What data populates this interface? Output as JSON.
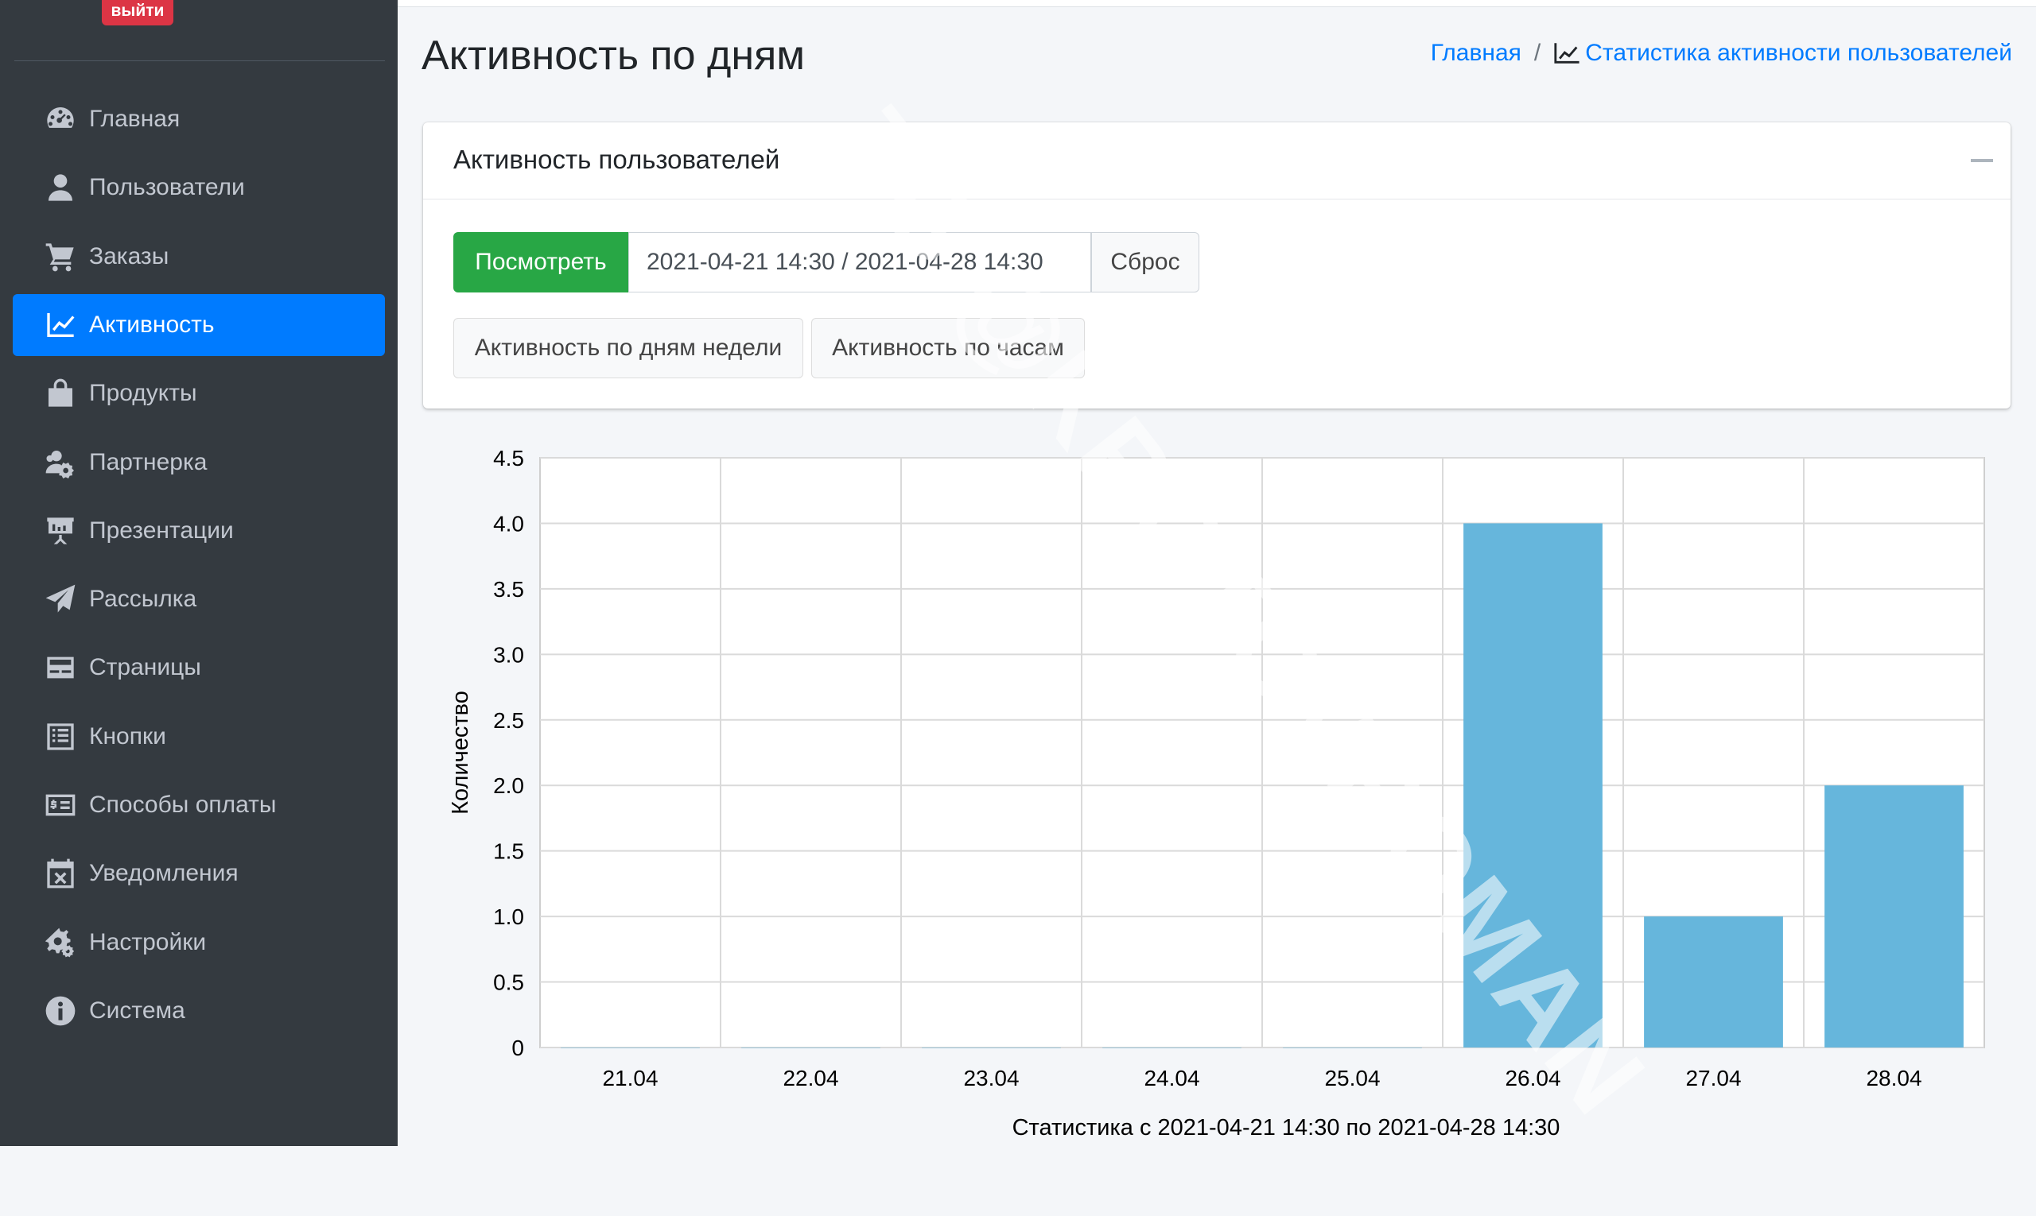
{
  "sidebar": {
    "logout_label": "выйти",
    "items": [
      {
        "label": "Главная",
        "icon": "dashboard-icon"
      },
      {
        "label": "Пользователи",
        "icon": "user-icon"
      },
      {
        "label": "Заказы",
        "icon": "cart-icon"
      },
      {
        "label": "Активность",
        "icon": "chart-line-icon",
        "active": true
      },
      {
        "label": "Продукты",
        "icon": "bag-icon"
      },
      {
        "label": "Партнерка",
        "icon": "users-cog-icon"
      },
      {
        "label": "Презентации",
        "icon": "presentation-icon"
      },
      {
        "label": "Рассылка",
        "icon": "paper-plane-icon"
      },
      {
        "label": "Страницы",
        "icon": "page-icon"
      },
      {
        "label": "Кнопки",
        "icon": "list-icon"
      },
      {
        "label": "Способы оплаты",
        "icon": "payment-card-icon"
      },
      {
        "label": "Уведомления",
        "icon": "calendar-x-icon"
      },
      {
        "label": "Настройки",
        "icon": "gears-icon"
      },
      {
        "label": "Система",
        "icon": "info-icon"
      }
    ]
  },
  "header": {
    "title": "Активность по дням",
    "breadcrumb_home": "Главная",
    "breadcrumb_sep": "/",
    "breadcrumb_current": "Статистика активности пользователей"
  },
  "card": {
    "title": "Активность пользователей",
    "view_button": "Посмотреть",
    "date_range": "2021-04-21 14:30 / 2021-04-28 14:30",
    "reset_button": "Сброс",
    "weekday_button": "Активность по дням недели",
    "hourly_button": "Активность по часам"
  },
  "chart_data": {
    "type": "bar",
    "categories": [
      "21.04",
      "22.04",
      "23.04",
      "24.04",
      "25.04",
      "26.04",
      "27.04",
      "28.04"
    ],
    "values": [
      0,
      0,
      0,
      0,
      0,
      4,
      1,
      2
    ],
    "ylabel": "Количество",
    "xlabel": "Статистика с 2021-04-21 14:30 по 2021-04-28 14:30",
    "ylim": [
      0,
      4.5
    ],
    "yticks": [
      "0",
      "0.5",
      "1.0",
      "1.5",
      "2.0",
      "2.5",
      "3.0",
      "3.5",
      "4.0",
      "4.5"
    ],
    "grid": true,
    "bar_color": "#66b6dc"
  },
  "watermark": "TG @KROTOVROMAN"
}
